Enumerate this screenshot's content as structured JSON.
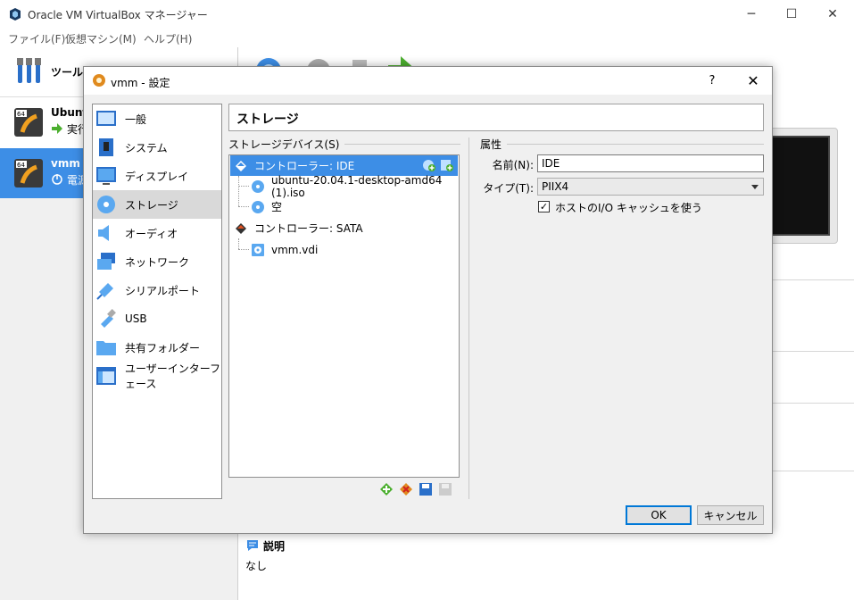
{
  "main": {
    "title": "Oracle VM VirtualBox マネージャー",
    "menu": [
      "ファイル(F)",
      "仮想マシン(M)",
      "ヘルプ(H)"
    ],
    "tools_label": "ツール",
    "vms": [
      {
        "name": "Ubuntu",
        "state": "実行"
      },
      {
        "name": "vmm",
        "state": "電源"
      }
    ],
    "description": {
      "title": "説明",
      "text": "なし"
    }
  },
  "dialog": {
    "title": "vmm - 設定",
    "help": "?",
    "close": "✕",
    "categories": [
      {
        "label": "一般",
        "icon": "general-icon"
      },
      {
        "label": "システム",
        "icon": "system-icon"
      },
      {
        "label": "ディスプレイ",
        "icon": "display-icon"
      },
      {
        "label": "ストレージ",
        "icon": "storage-icon"
      },
      {
        "label": "オーディオ",
        "icon": "audio-icon"
      },
      {
        "label": "ネットワーク",
        "icon": "network-icon"
      },
      {
        "label": "シリアルポート",
        "icon": "serial-port-icon"
      },
      {
        "label": "USB",
        "icon": "usb-icon"
      },
      {
        "label": "共有フォルダー",
        "icon": "shared-folder-icon"
      },
      {
        "label": "ユーザーインターフェース",
        "icon": "user-interface-icon"
      }
    ],
    "selected_category": "ストレージ",
    "heading": "ストレージ",
    "storage_devices_label": "ストレージデバイス(S)",
    "attributes_label": "属性",
    "tree": [
      {
        "label": "コントローラー: IDE",
        "type": "controller",
        "selected": true
      },
      {
        "label": "ubuntu-20.04.1-desktop-amd64 (1).iso",
        "type": "optical"
      },
      {
        "label": "空",
        "type": "optical"
      },
      {
        "label": "コントローラー: SATA",
        "type": "controller"
      },
      {
        "label": "vmm.vdi",
        "type": "hard-disk"
      }
    ],
    "props": {
      "name_label": "名前(N):",
      "name_value": "IDE",
      "type_label": "タイプ(T):",
      "type_value": "PIIX4",
      "hostio_label": "ホストのI/O キャッシュを使う",
      "hostio_checked": true
    },
    "ok_label": "OK",
    "cancel_label": "キャンセル"
  },
  "colors": {
    "selection": "#3d8ee6",
    "dialog_bg": "#f0f0f0",
    "ok_border": "#0078d7"
  }
}
